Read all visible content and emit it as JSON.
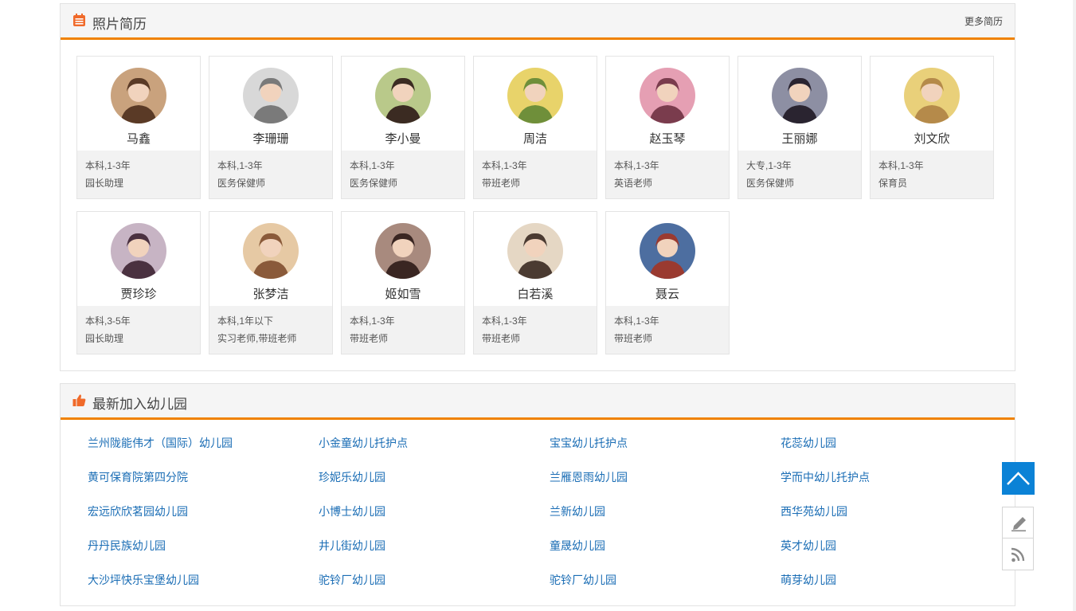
{
  "resumes": {
    "title": "照片简历",
    "more_label": "更多简历",
    "cards": [
      {
        "name": "马鑫",
        "edu": "本科,1-3年",
        "job": "园长助理"
      },
      {
        "name": "李珊珊",
        "edu": "本科,1-3年",
        "job": "医务保健师"
      },
      {
        "name": "李小曼",
        "edu": "本科,1-3年",
        "job": "医务保健师"
      },
      {
        "name": "周洁",
        "edu": "本科,1-3年",
        "job": "带班老师"
      },
      {
        "name": "赵玉琴",
        "edu": "本科,1-3年",
        "job": "英语老师"
      },
      {
        "name": "王丽娜",
        "edu": "大专,1-3年",
        "job": "医务保健师"
      },
      {
        "name": "刘文欣",
        "edu": "本科,1-3年",
        "job": "保育员"
      },
      {
        "name": "贾珍珍",
        "edu": "本科,3-5年",
        "job": "园长助理"
      },
      {
        "name": "张梦洁",
        "edu": "本科,1年以下",
        "job": "实习老师,带班老师"
      },
      {
        "name": "姬如雪",
        "edu": "本科,1-3年",
        "job": "带班老师"
      },
      {
        "name": "白若溪",
        "edu": "本科,1-3年",
        "job": "带班老师"
      },
      {
        "name": "聂云",
        "edu": "本科,1-3年",
        "job": "带班老师"
      }
    ]
  },
  "kindergartens": {
    "title": "最新加入幼儿园",
    "links": [
      "兰州陇能伟才（国际）幼儿园",
      "小金童幼儿托护点",
      "宝宝幼儿托护点",
      "花蕊幼儿园",
      "黄可保育院第四分院",
      "珍妮乐幼儿园",
      "兰雁恩雨幼儿园",
      "学而中幼儿托护点",
      "宏远欣欣茗园幼儿园",
      "小博士幼儿园",
      "兰新幼儿园",
      "西华苑幼儿园",
      "丹丹民族幼儿园",
      "井儿街幼儿园",
      "童晟幼儿园",
      "英才幼儿园",
      "大沙坪快乐宝堡幼儿园",
      "驼铃厂幼儿园",
      "驼铃厂幼儿园",
      "萌芽幼儿园"
    ]
  },
  "icons": {
    "calendar": "calendar-icon",
    "thumbs_up": "thumbs-up-icon",
    "back_to_top": "chevron-up-icon",
    "edit": "pencil-icon",
    "rss": "rss-icon"
  },
  "colors": {
    "accent": "#f08200",
    "link": "#1a6db5",
    "back_to_top_bg": "#0b82d6"
  }
}
